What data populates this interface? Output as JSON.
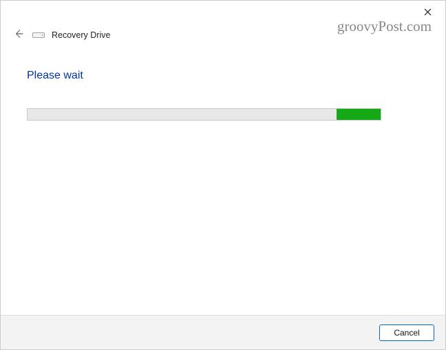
{
  "header": {
    "title": "Recovery Drive"
  },
  "main": {
    "heading": "Please wait",
    "progress": {
      "fill_left_pct": 87.5,
      "fill_width_pct": 12.5
    }
  },
  "footer": {
    "cancel_label": "Cancel"
  },
  "watermark": "groovyPost.com"
}
